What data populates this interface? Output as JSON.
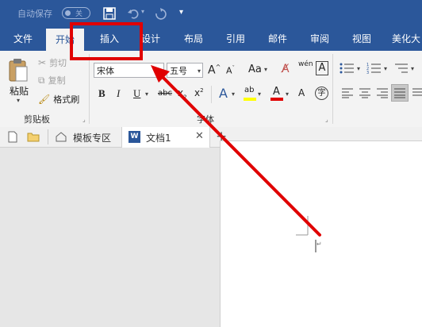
{
  "titlebar": {
    "autosave_label": "自动保存",
    "autosave_toggle": "关"
  },
  "tabs": [
    {
      "label": "文件"
    },
    {
      "label": "开始"
    },
    {
      "label": "插入"
    },
    {
      "label": "设计"
    },
    {
      "label": "布局"
    },
    {
      "label": "引用"
    },
    {
      "label": "邮件"
    },
    {
      "label": "审阅"
    },
    {
      "label": "视图"
    },
    {
      "label": "美化大"
    }
  ],
  "clipboard": {
    "paste": "粘贴",
    "cut": "剪切",
    "copy": "复制",
    "format_painter": "格式刷",
    "group": "剪贴板"
  },
  "font": {
    "name": "宋体",
    "size": "五号",
    "group": "字体",
    "phonetic": "wén",
    "case": "Aa"
  },
  "doctabs": {
    "template_zone": "模板专区",
    "document": "文档1"
  },
  "colors": {
    "accent": "#2b579a",
    "annotation": "#e00000"
  }
}
